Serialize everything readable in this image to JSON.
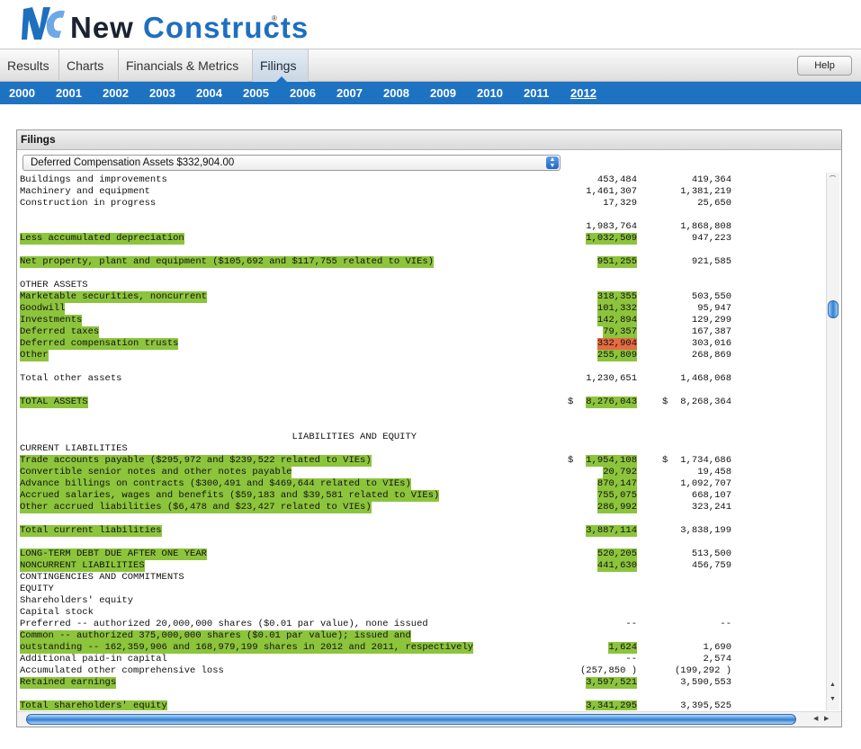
{
  "brand": {
    "word1": "New",
    "word2": "Constructs",
    "reg": "®",
    "logo_letters": "NC"
  },
  "tabs": [
    {
      "label": "Results",
      "active": false
    },
    {
      "label": "Charts",
      "active": false
    },
    {
      "label": "Financials & Metrics",
      "active": false
    },
    {
      "label": "Filings",
      "active": true
    }
  ],
  "help_label": "Help",
  "years": [
    {
      "label": "2000",
      "active": false
    },
    {
      "label": "2001",
      "active": false
    },
    {
      "label": "2002",
      "active": false
    },
    {
      "label": "2003",
      "active": false
    },
    {
      "label": "2004",
      "active": false
    },
    {
      "label": "2005",
      "active": false
    },
    {
      "label": "2006",
      "active": false
    },
    {
      "label": "2007",
      "active": false
    },
    {
      "label": "2008",
      "active": false
    },
    {
      "label": "2009",
      "active": false
    },
    {
      "label": "2010",
      "active": false
    },
    {
      "label": "2011",
      "active": false
    },
    {
      "label": "2012",
      "active": true
    }
  ],
  "panel": {
    "title": "Filings",
    "select_value": "Deferred Compensation Assets $332,904.00"
  },
  "colors": {
    "brand_blue": "#1e72c2",
    "highlight_green": "#8cc43c",
    "highlight_orange": "#e56b43"
  },
  "lines": [
    {
      "text": "Buildings and improvements",
      "hl": false,
      "v1": "453,484",
      "v2": "419,364"
    },
    {
      "text": "Machinery and equipment",
      "hl": false,
      "v1": "1,461,307",
      "v2": "1,381,219"
    },
    {
      "text": "Construction in progress",
      "hl": false,
      "v1": "17,329",
      "v2": "25,650"
    },
    {
      "text": "",
      "hl": false,
      "v1": "",
      "v2": ""
    },
    {
      "text": "",
      "hl": false,
      "v1": "1,983,764",
      "v2": "1,868,808"
    },
    {
      "text": "Less accumulated depreciation",
      "hl": true,
      "v1": "1,032,509",
      "v1hl": "g",
      "v2": "947,223"
    },
    {
      "text": "",
      "hl": false,
      "v1": "",
      "v2": ""
    },
    {
      "text": "Net property, plant and equipment ($105,692 and $117,755 related to VIEs)",
      "hl": true,
      "v1": "951,255",
      "v1hl": "g",
      "v2": "921,585"
    },
    {
      "text": "",
      "hl": false,
      "v1": "",
      "v2": ""
    },
    {
      "text": "OTHER ASSETS",
      "hl": false,
      "v1": "",
      "v2": ""
    },
    {
      "text": "Marketable securities, noncurrent",
      "hl": true,
      "v1": "318,355",
      "v1hl": "g",
      "v2": "503,550"
    },
    {
      "text": "Goodwill",
      "hl": true,
      "v1": "101,332",
      "v1hl": "g",
      "v2": "95,947"
    },
    {
      "text": "Investments",
      "hl": true,
      "v1": "142,894",
      "v1hl": "g",
      "v2": "129,299"
    },
    {
      "text": "Deferred taxes",
      "hl": true,
      "v1": "79,357",
      "v1hl": "g",
      "v2": "167,387"
    },
    {
      "text": "Deferred compensation trusts",
      "hl": true,
      "v1": "332,904",
      "v1hl": "o",
      "v2": "303,016"
    },
    {
      "text": "Other",
      "hl": true,
      "v1": "255,809",
      "v1hl": "g",
      "v2": "268,869"
    },
    {
      "text": "",
      "hl": false,
      "v1": "",
      "v2": ""
    },
    {
      "text": "Total other assets",
      "hl": false,
      "v1": "1,230,651",
      "v2": "1,468,068"
    },
    {
      "text": "",
      "hl": false,
      "v1": "",
      "v2": ""
    },
    {
      "text": "TOTAL ASSETS",
      "hl": true,
      "v1": "8,276,043",
      "v1hl": "g",
      "v1pre": "$ ",
      "v2": "8,268,364",
      "v2pre": "$ "
    },
    {
      "text": "",
      "hl": false,
      "v1": "",
      "v2": ""
    },
    {
      "text": "",
      "hl": false,
      "v1": "",
      "v2": ""
    },
    {
      "text": "                                                LIABILITIES AND EQUITY",
      "hl": false,
      "v1": "",
      "v2": ""
    },
    {
      "text": "CURRENT LIABILITIES",
      "hl": false,
      "v1": "",
      "v2": ""
    },
    {
      "text": "Trade accounts payable ($295,972 and $239,522 related to VIEs)",
      "hl": true,
      "v1": "1,954,108",
      "v1hl": "g",
      "v1pre": "$ ",
      "v2": "1,734,686",
      "v2pre": "$ "
    },
    {
      "text": "Convertible senior notes and other notes payable",
      "hl": true,
      "v1": "20,792",
      "v1hl": "g",
      "v2": "19,458"
    },
    {
      "text": "Advance billings on contracts ($300,491 and $469,644 related to VIEs)",
      "hl": true,
      "v1": "870,147",
      "v1hl": "g",
      "v2": "1,092,707"
    },
    {
      "text": "Accrued salaries, wages and benefits ($59,183 and $39,581 related to VIEs)",
      "hl": true,
      "v1": "755,075",
      "v1hl": "g",
      "v2": "668,107"
    },
    {
      "text": "Other accrued liabilities ($6,478 and $23,427 related to VIEs)",
      "hl": true,
      "v1": "286,992",
      "v1hl": "g",
      "v2": "323,241"
    },
    {
      "text": "",
      "hl": false,
      "v1": "",
      "v2": ""
    },
    {
      "text": "Total current liabilities",
      "hl": true,
      "v1": "3,887,114",
      "v1hl": "g",
      "v2": "3,838,199"
    },
    {
      "text": "",
      "hl": false,
      "v1": "",
      "v2": ""
    },
    {
      "text": "LONG-TERM DEBT DUE AFTER ONE YEAR",
      "hl": true,
      "v1": "520,205",
      "v1hl": "g",
      "v2": "513,500"
    },
    {
      "text": "NONCURRENT LIABILITIES",
      "hl": true,
      "v1": "441,630",
      "v1hl": "g",
      "v2": "456,759"
    },
    {
      "text": "CONTINGENCIES AND COMMITMENTS",
      "hl": false,
      "v1": "",
      "v2": ""
    },
    {
      "text": "EQUITY",
      "hl": false,
      "v1": "",
      "v2": ""
    },
    {
      "text": "Shareholders' equity",
      "hl": false,
      "v1": "",
      "v2": ""
    },
    {
      "text": "Capital stock",
      "hl": false,
      "v1": "",
      "v2": ""
    },
    {
      "text": "Preferred -- authorized 20,000,000 shares ($0.01 par value), none issued",
      "hl": false,
      "v1": "--",
      "v2": "--"
    },
    {
      "text": "Common -- authorized 375,000,000 shares ($0.01 par value); issued and",
      "hl": true,
      "v1": "",
      "v2": ""
    },
    {
      "text": "outstanding -- 162,359,906 and 168,979,199 shares in 2012 and 2011, respectively",
      "hl": true,
      "v1": "1,624",
      "v1hl": "g",
      "v2": "1,690"
    },
    {
      "text": "Additional paid-in capital",
      "hl": false,
      "v1": "--",
      "v2": "2,574"
    },
    {
      "text": "Accumulated other comprehensive loss",
      "hl": false,
      "v1": "(257,850 )",
      "v2": "(199,292 )"
    },
    {
      "text": "Retained earnings",
      "hl": true,
      "v1": "3,597,521",
      "v1hl": "g",
      "v2": "3,590,553"
    },
    {
      "text": "",
      "hl": false,
      "v1": "",
      "v2": ""
    },
    {
      "text": "Total shareholders' equity",
      "hl": true,
      "v1": "3,341,295",
      "v1hl": "g",
      "v2": "3,395,525"
    }
  ]
}
